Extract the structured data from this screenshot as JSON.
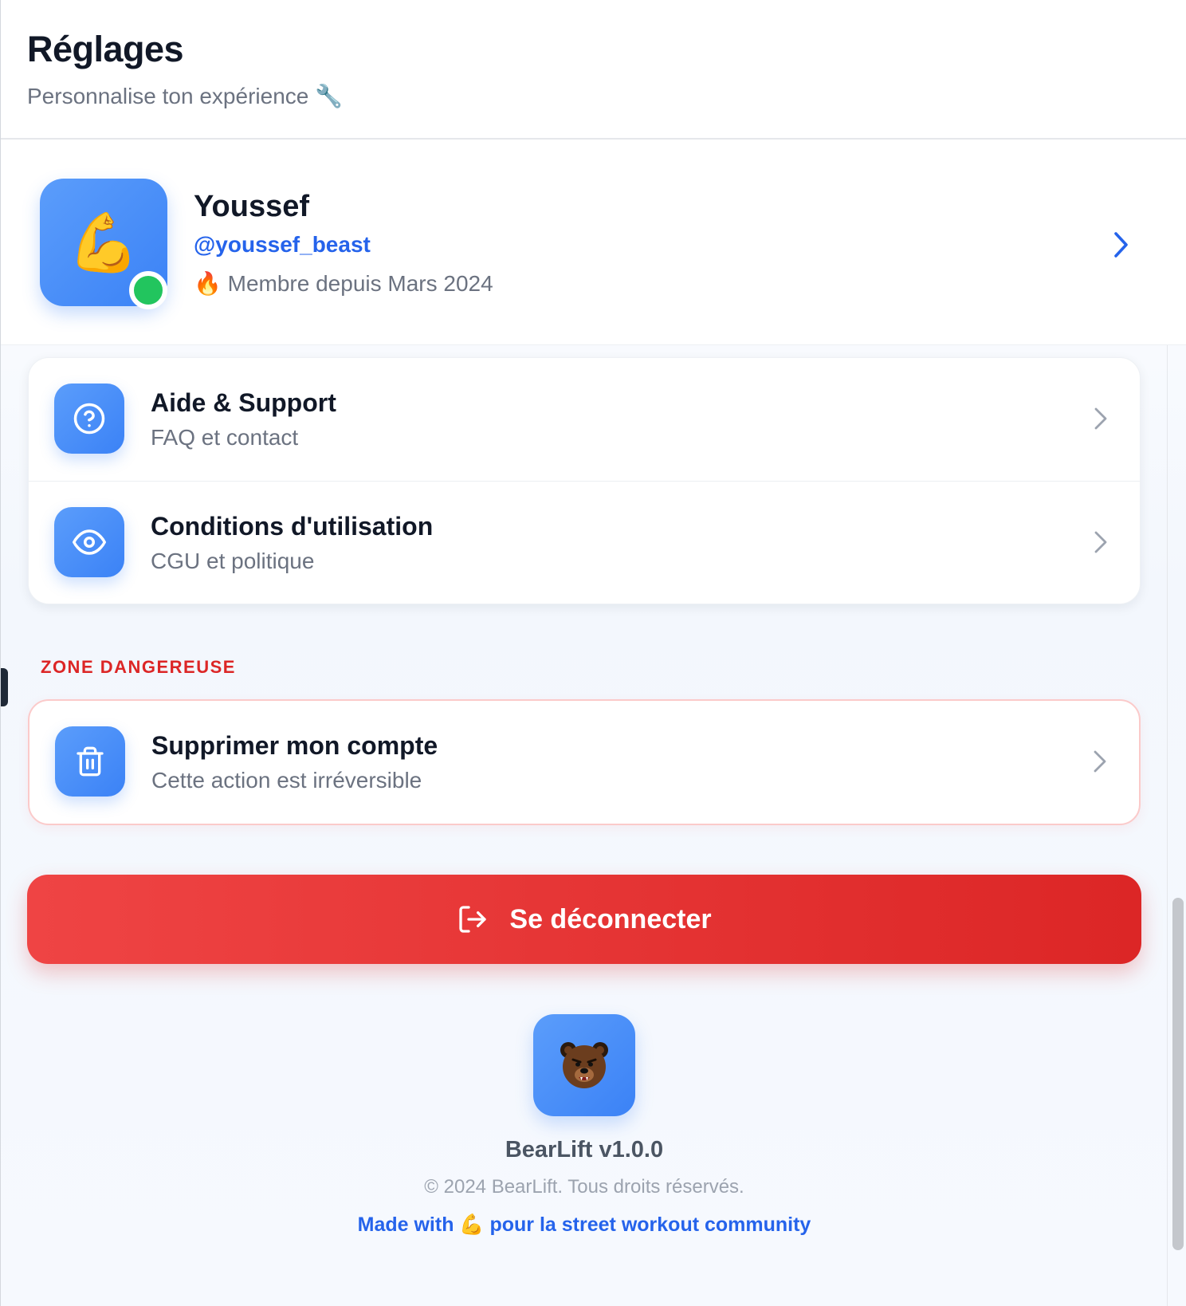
{
  "header": {
    "title": "Réglages",
    "subtitle": "Personnalise ton expérience 🔧"
  },
  "profile": {
    "avatar_emoji": "💪",
    "name": "Youssef",
    "handle": "@youssef_beast",
    "member_since": "🔥 Membre depuis Mars 2024",
    "status": "online",
    "status_color": "#22c55e"
  },
  "support_section": {
    "items": [
      {
        "icon": "help-circle-icon",
        "title": "Aide & Support",
        "subtitle": "FAQ et contact"
      },
      {
        "icon": "eye-icon",
        "title": "Conditions d'utilisation",
        "subtitle": "CGU et politique"
      }
    ]
  },
  "danger_zone": {
    "label": "ZONE DANGEREUSE",
    "item": {
      "icon": "trash-icon",
      "title": "Supprimer mon compte",
      "subtitle": "Cette action est irréversible"
    }
  },
  "logout": {
    "label": "Se déconnecter",
    "icon": "logout-icon"
  },
  "footer": {
    "logo_icon": "bear-icon",
    "version": "BearLift v1.0.0",
    "copyright": "© 2024 BearLift. Tous droits réservés.",
    "made_with": "Made with 💪 pour la street workout community"
  },
  "colors": {
    "accent": "#3b82f6",
    "link": "#2563eb",
    "danger": "#dc2626",
    "text_primary": "#111827",
    "text_secondary": "#6b7280"
  }
}
